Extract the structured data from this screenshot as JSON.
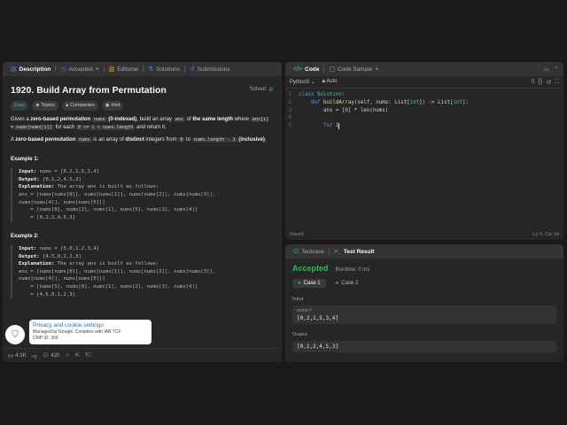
{
  "left_panel": {
    "tabs": [
      {
        "label": "Description",
        "icon": "document-icon"
      },
      {
        "label": "Accepted",
        "icon": "clock-icon"
      },
      {
        "label": "Editorial",
        "icon": "book-icon"
      },
      {
        "label": "Solutions",
        "icon": "flask-icon"
      },
      {
        "label": "Submissions",
        "icon": "history-icon"
      }
    ],
    "title": "1920. Build Array from Permutation",
    "status": "Solved",
    "chips": [
      "Easy",
      "Topics",
      "Companies",
      "Hint"
    ],
    "para1": {
      "t1": "Given a ",
      "b1": "zero-based permutation",
      "c1": "nums",
      "b2": "(0-indexed)",
      "t2": ", build an array ",
      "c2": "ans",
      "t3": " of ",
      "b3": "the same length",
      "t4": " where",
      "c3": "ans[i] = nums[nums[i]]",
      "t5": " for each ",
      "c4": "0 <= i < nums.length",
      "t6": " and return it."
    },
    "para2": {
      "t1": "A ",
      "b1": "zero-based permutation",
      "c1": "nums",
      "t2": " is an array of ",
      "b2": "distinct",
      "t3": " integers from ",
      "c2": "0",
      "t4": " to ",
      "c3": "nums.length - 1",
      "b3": "(inclusive)",
      "t5": "."
    },
    "example1": {
      "heading": "Example 1:",
      "input_label": "Input:",
      "input": " nums = [0,2,1,5,3,4]",
      "output_label": "Output:",
      "output": " [0,1,2,4,5,3]",
      "explanation_label": "Explanation:",
      "explanation": " The array ans is built as follows:\nans = [nums[nums[0]], nums[nums[1]], nums[nums[2]], nums[nums[3]],\nnums[nums[4]], nums[nums[5]]]\n    = [nums[0], nums[2], nums[1], nums[5], nums[3], nums[4]]\n    = [0,1,2,4,5,3]"
    },
    "example2": {
      "heading": "Example 2:",
      "input_label": "Input:",
      "input": " nums = [5,0,1,2,3,4]",
      "output_label": "Output:",
      "output": " [4,5,0,1,2,3]",
      "explanation_label": "Explanation:",
      "explanation": " The array ans is built as follows:\nans = [nums[nums[0]], nums[nums[1]], nums[nums[2]], nums[nums[3]],\nnums[nums[4]], nums[nums[5]]]\n    = [nums[5], nums[0], nums[1], nums[2], nums[3], nums[4]]\n    = [4,5,0,1,2,3]"
    },
    "bottom": {
      "likes": "4.1K",
      "comments": "420"
    }
  },
  "cookie": {
    "title": "Privacy and cookie settings",
    "sub1": "Managed by Google. Complies with IAB TCF.",
    "sub2": "CMP ID: 300"
  },
  "code_panel": {
    "tabs": [
      {
        "label": "Code",
        "icon": "code-icon"
      },
      {
        "label": "Code Sample",
        "icon": "file-icon"
      }
    ],
    "language": "Python3",
    "mode": "Auto",
    "lines": [
      {
        "n": "1",
        "text": "class Solution:"
      },
      {
        "n": "2",
        "text": "    def buildArray(self, nums: List[int]) -> List[int]:"
      },
      {
        "n": "3",
        "text": "        ans = [0] * len(nums)"
      },
      {
        "n": "4",
        "text": ""
      },
      {
        "n": "5",
        "text": "        for i"
      }
    ],
    "status_left": "Saved",
    "status_right": "Ln 5, Col 14"
  },
  "result_panel": {
    "tabs": [
      {
        "label": "Testcase",
        "icon": "check-square-icon"
      },
      {
        "label": "Test Result",
        "icon": "terminal-icon"
      }
    ],
    "verdict": "Accepted",
    "runtime": "Runtime: 0 ms",
    "cases": [
      "Case 1",
      "Case 2"
    ],
    "input_label": "Input",
    "var_name": "nums =",
    "input_value": "[0,2,1,5,3,4]",
    "output_label": "Output",
    "output_value": "[0,1,2,4,5,3]"
  }
}
